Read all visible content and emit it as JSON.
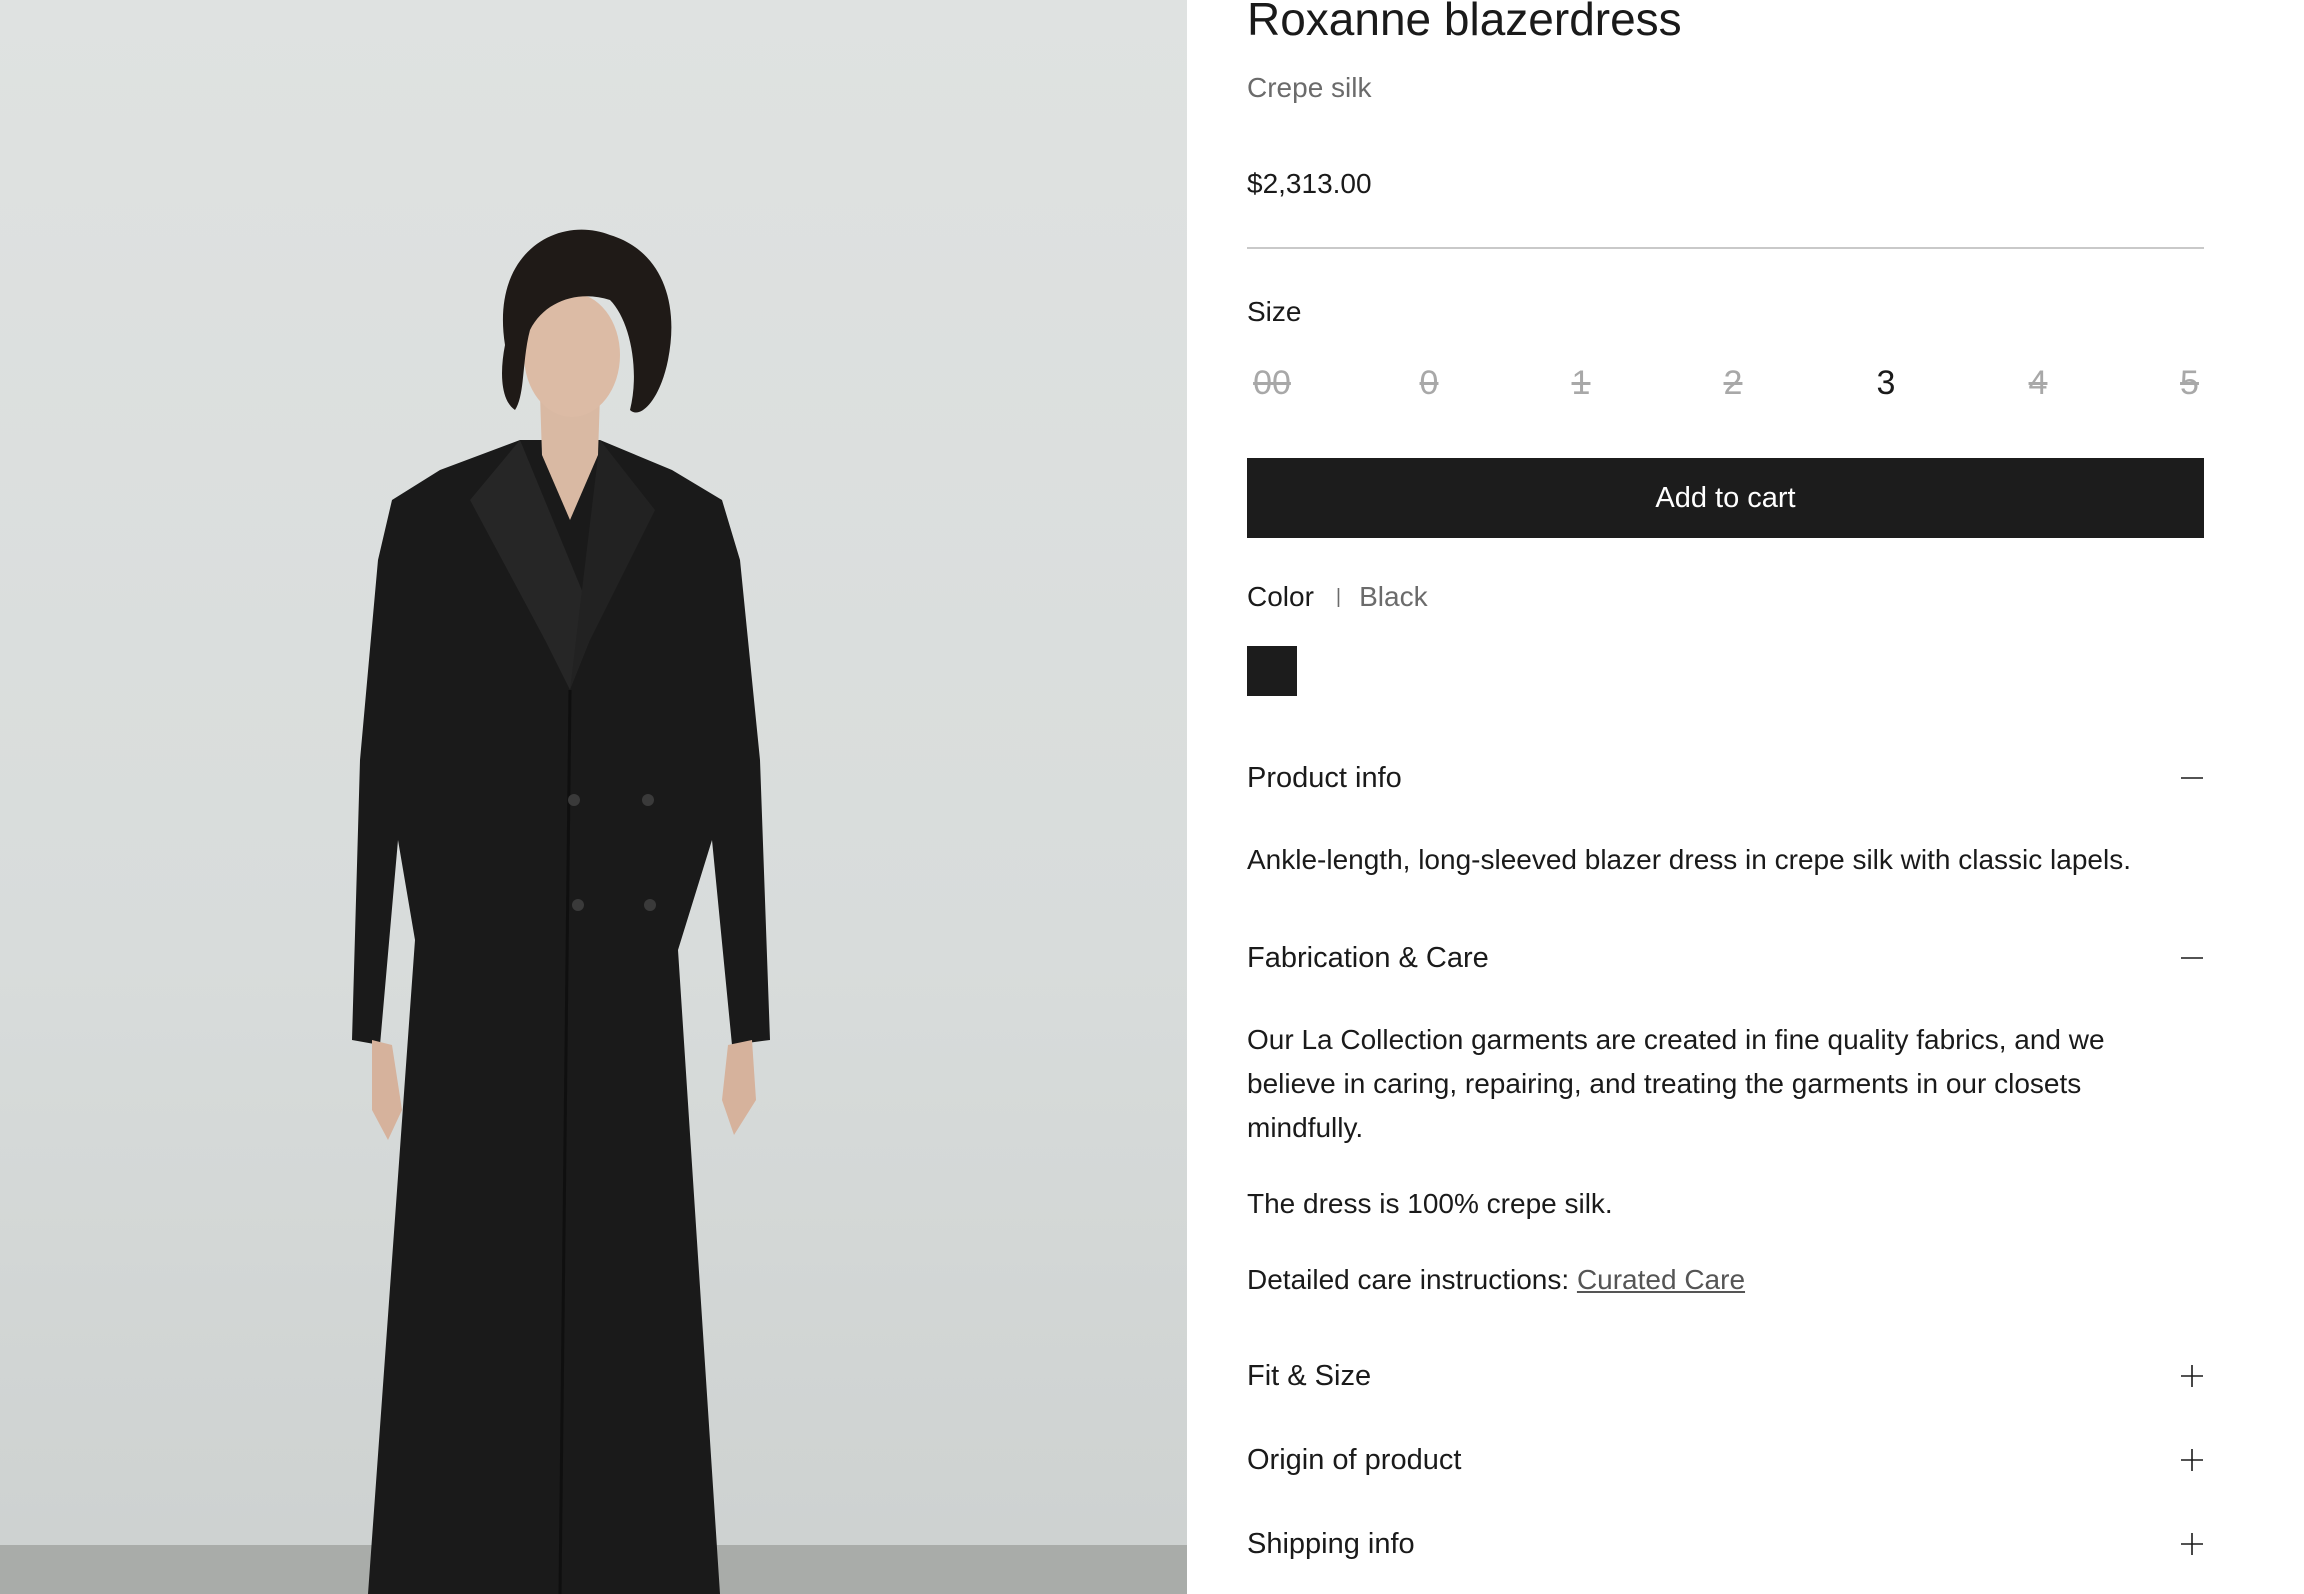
{
  "product": {
    "title": "Roxanne blazerdress",
    "subtitle": "Crepe silk",
    "price": "$2,313.00"
  },
  "size": {
    "label": "Size",
    "options": [
      {
        "label": "00",
        "available": false
      },
      {
        "label": "0",
        "available": false
      },
      {
        "label": "1",
        "available": false
      },
      {
        "label": "2",
        "available": false
      },
      {
        "label": "3",
        "available": true
      },
      {
        "label": "4",
        "available": false
      },
      {
        "label": "5",
        "available": false
      }
    ]
  },
  "cart": {
    "label": "Add to cart"
  },
  "color": {
    "label": "Color",
    "separator": "|",
    "value": "Black",
    "swatch": "#1c1c1c"
  },
  "accordion": {
    "product_info": {
      "label": "Product info",
      "state": "expanded",
      "text": "Ankle-length, long-sleeved blazer dress in crepe silk with classic lapels."
    },
    "fabrication": {
      "label": "Fabrication & Care",
      "state": "expanded",
      "paragraph1": "Our La Collection garments are created in fine quality fabrics, and we believe in caring, repairing, and treating the garments in our closets mindfully.",
      "paragraph2": "The dress is 100% crepe silk.",
      "care_prefix": "Detailed care instructions: ",
      "care_link": "Curated Care"
    },
    "fit_size": {
      "label": "Fit & Size",
      "state": "collapsed"
    },
    "origin": {
      "label": "Origin of product",
      "state": "collapsed"
    },
    "shipping": {
      "label": "Shipping info",
      "state": "collapsed"
    }
  },
  "icons": {
    "expanded": "minus-icon",
    "collapsed": "plus-icon"
  },
  "colors": {
    "text": "#1a1a1a",
    "muted": "#6b6b6b",
    "unavailable": "#a8a8a8",
    "button": "#1c1c1c",
    "photo_bg": "#dcdfde"
  }
}
